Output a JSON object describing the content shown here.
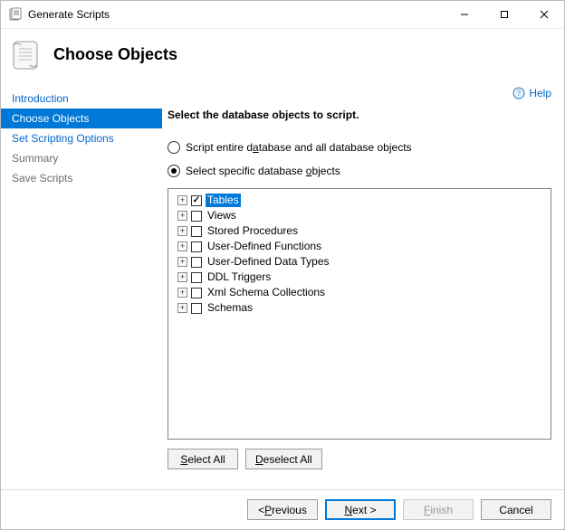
{
  "window": {
    "title": "Generate Scripts"
  },
  "header": {
    "page_title": "Choose Objects"
  },
  "help": {
    "label": "Help"
  },
  "sidebar": {
    "items": [
      {
        "label": "Introduction",
        "state": "link"
      },
      {
        "label": "Choose Objects",
        "state": "selected"
      },
      {
        "label": "Set Scripting Options",
        "state": "link"
      },
      {
        "label": "Summary",
        "state": "disabled"
      },
      {
        "label": "Save Scripts",
        "state": "disabled"
      }
    ]
  },
  "main": {
    "section_title": "Select the database objects to script.",
    "radio_entire": {
      "label": "Script entire database and all database objects",
      "checked": false,
      "mnemonic_index": 14
    },
    "radio_specific": {
      "label": "Select specific database objects",
      "checked": true,
      "mnemonic_index": 25
    },
    "tree": {
      "items": [
        {
          "label": "Tables",
          "checked": true,
          "highlighted": true
        },
        {
          "label": "Views",
          "checked": false
        },
        {
          "label": "Stored Procedures",
          "checked": false
        },
        {
          "label": "User-Defined Functions",
          "checked": false
        },
        {
          "label": "User-Defined Data Types",
          "checked": false
        },
        {
          "label": "DDL Triggers",
          "checked": false
        },
        {
          "label": "Xml Schema Collections",
          "checked": false
        },
        {
          "label": "Schemas",
          "checked": false
        }
      ]
    },
    "select_all": "Select All",
    "deselect_all": "Deselect All"
  },
  "footer": {
    "previous": "< Previous",
    "next": "Next >",
    "finish": "Finish",
    "cancel": "Cancel"
  }
}
